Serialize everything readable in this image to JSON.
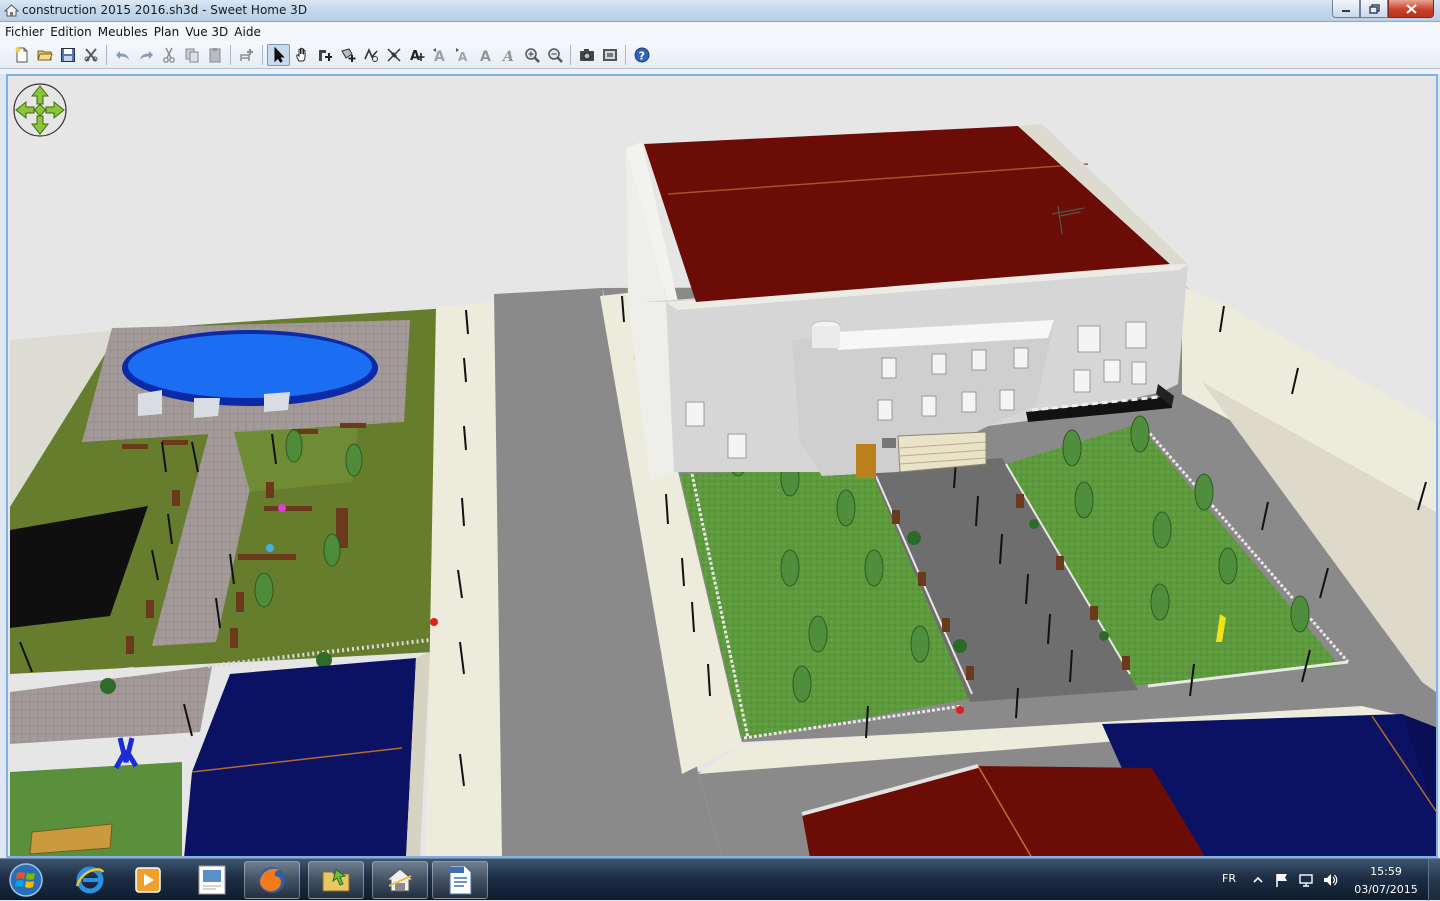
{
  "window": {
    "title": "construction 2015 2016.sh3d - Sweet Home 3D",
    "icon": "sweet-home-3d-icon",
    "controls": [
      "minimize-icon",
      "maximize-icon",
      "close-icon"
    ]
  },
  "menu": {
    "items": [
      {
        "label": "Fichier"
      },
      {
        "label": "Edition"
      },
      {
        "label": "Meubles"
      },
      {
        "label": "Plan"
      },
      {
        "label": "Vue 3D"
      },
      {
        "label": "Aide"
      }
    ]
  },
  "toolbar": {
    "groups": [
      [
        "new-home-icon",
        "open-icon",
        "save-icon",
        "cut-preferences-icon"
      ],
      [
        "undo-icon",
        "redo-icon",
        "cut-icon",
        "copy-icon",
        "paste-icon"
      ],
      [
        "add-furniture-icon"
      ],
      [
        "select-mode-icon",
        "pan-mode-icon",
        "create-walls-icon",
        "create-rooms-icon",
        "create-polylines-icon",
        "create-dimensions-icon",
        "create-labels-icon",
        "increase-text-icon",
        "decrease-text-icon",
        "bold-text-icon",
        "italic-text-icon",
        "zoom-in-icon",
        "zoom-out-icon"
      ],
      [
        "create-photo-icon",
        "create-video-icon"
      ],
      [
        "help-icon"
      ]
    ],
    "active": "select-mode-icon"
  },
  "view3d": {
    "navigation": "navigation-arrows-icon"
  },
  "taskbar": {
    "start": "windows-start-icon",
    "items": [
      "internet-explorer-icon",
      "media-player-icon",
      "document-thumbnail-icon",
      "firefox-icon",
      "file-explorer-icon",
      "sweet-home-3d-icon",
      "odf-document-icon"
    ],
    "tray": {
      "language": "FR",
      "icons": [
        "show-hidden-icons-icon",
        "flag-icon",
        "network-icon",
        "volume-icon"
      ],
      "time": "15:59",
      "date": "03/07/2015"
    }
  },
  "colors": {
    "roof_red": "#6b0c06",
    "roof_blue": "#0b1264",
    "lawn_green": "#667d2d",
    "grass_green": "#5f9a3e",
    "pool_blue": "#1b6ef2",
    "asphalt": "#8a8a8a",
    "selection_border": "#7fb0e6"
  }
}
